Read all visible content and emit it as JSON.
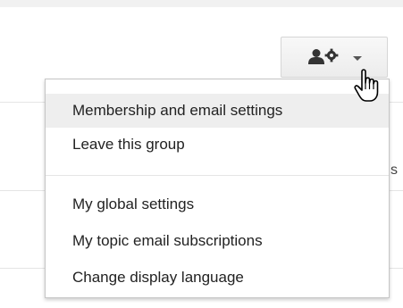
{
  "icons": {
    "settings_button": "person-gear-icon",
    "dropdown": "caret-down-icon",
    "cursor": "hand-pointer-icon"
  },
  "edge_text": "s",
  "menu": {
    "section_group": [
      {
        "label": "Membership and email settings",
        "highlighted": true
      },
      {
        "label": "Leave this group",
        "highlighted": false
      }
    ],
    "section_global": [
      {
        "label": "My global settings"
      },
      {
        "label": "My topic email subscriptions"
      },
      {
        "label": "Change display language"
      }
    ]
  },
  "colors": {
    "hover_bg": "#eeeeee",
    "text": "#222222",
    "border": "#c6c6c6"
  }
}
